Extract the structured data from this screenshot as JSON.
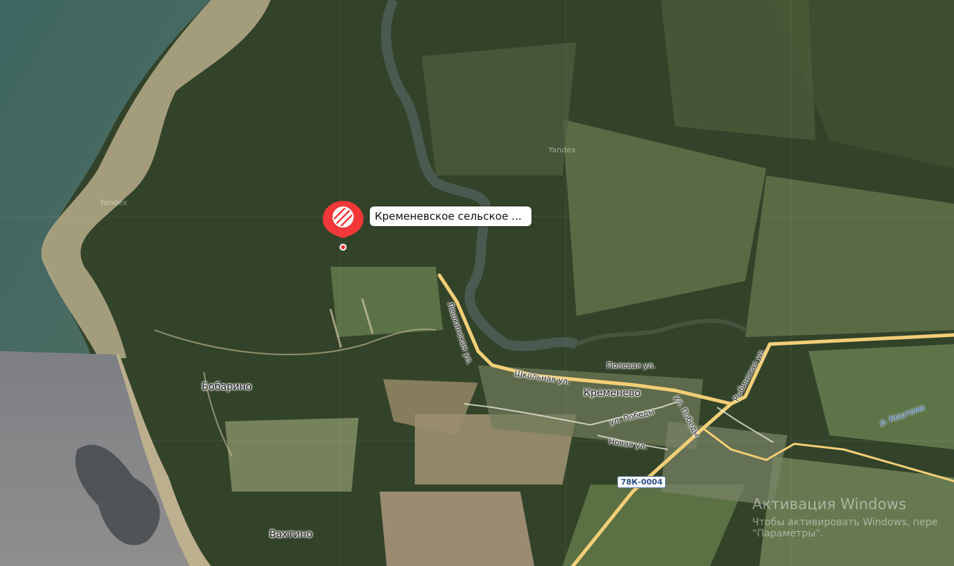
{
  "map": {
    "tile_provider_watermark": "Yandex",
    "colors": {
      "forest": "#2f3d25",
      "field": "#566b45",
      "light_field": "#8a9668",
      "road": "#f4d27a",
      "pin": "#f23838",
      "water": "#3b5f5a"
    }
  },
  "poi": {
    "callout_text": "Кременевское сельское ...",
    "icon": "striped-circle-icon"
  },
  "places": {
    "kremenevo": "Кременево",
    "bobarino": "Бобарино",
    "vakhtino": "Вахтино"
  },
  "streets": {
    "leshkinskaya": "Лешкинская ул.",
    "shkolnaya": "Школьная ул.",
    "polevaya": "Полевая ул.",
    "pobedy_1": "ул. Победы",
    "pobedy_2": "ул. Победы",
    "rybinskaya": "Рыбинская ул.",
    "novaya": "Новая ул."
  },
  "river": {
    "keshtoma": "р. Кештома"
  },
  "road_badge": "78К-0004",
  "os_overlay": {
    "title": "Активация Windows",
    "line1": "Чтобы активировать Windows, пере",
    "line2": "\"Параметры\"."
  }
}
